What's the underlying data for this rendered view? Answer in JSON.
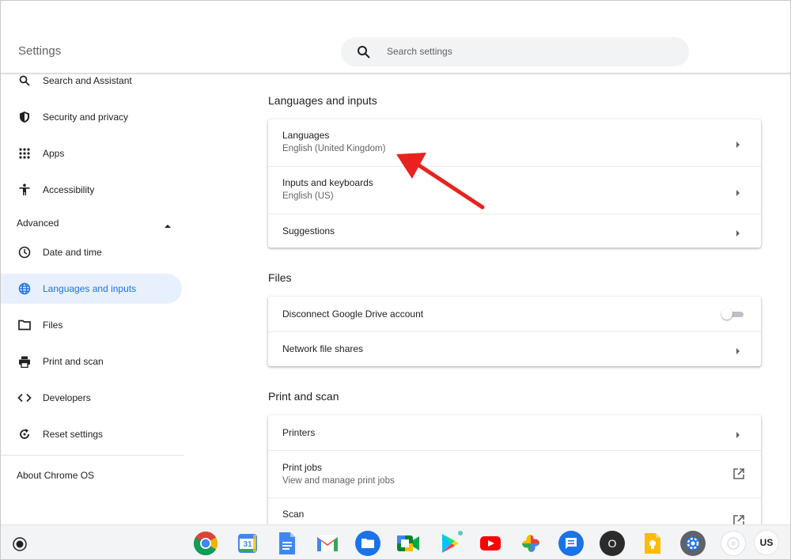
{
  "header": {
    "title": "Settings",
    "search_placeholder": "Search settings"
  },
  "sidebar": {
    "items": [
      {
        "label": "Search and Assistant",
        "icon": "search-icon"
      },
      {
        "label": "Security and privacy",
        "icon": "shield-icon"
      },
      {
        "label": "Apps",
        "icon": "apps-grid-icon"
      },
      {
        "label": "Accessibility",
        "icon": "accessibility-icon"
      }
    ],
    "advanced_label": "Advanced",
    "advanced_items": [
      {
        "label": "Date and time",
        "icon": "clock-icon"
      },
      {
        "label": "Languages and inputs",
        "icon": "globe-icon",
        "active": true
      },
      {
        "label": "Files",
        "icon": "folder-icon"
      },
      {
        "label": "Print and scan",
        "icon": "printer-icon"
      },
      {
        "label": "Developers",
        "icon": "code-icon"
      },
      {
        "label": "Reset settings",
        "icon": "reset-icon"
      }
    ],
    "about_label": "About Chrome OS"
  },
  "main": {
    "sections": [
      {
        "title": "Languages and inputs",
        "rows": [
          {
            "title": "Languages",
            "subtitle": "English (United Kingdom)",
            "action": "chevron"
          },
          {
            "title": "Inputs and keyboards",
            "subtitle": "English (US)",
            "action": "chevron"
          },
          {
            "title": "Suggestions",
            "action": "chevron"
          }
        ]
      },
      {
        "title": "Files",
        "rows": [
          {
            "title": "Disconnect Google Drive account",
            "action": "toggle",
            "toggle_on": false
          },
          {
            "title": "Network file shares",
            "action": "chevron"
          }
        ]
      },
      {
        "title": "Print and scan",
        "rows": [
          {
            "title": "Printers",
            "action": "chevron"
          },
          {
            "title": "Print jobs",
            "subtitle": "View and manage print jobs",
            "action": "external"
          },
          {
            "title": "Scan",
            "action": "external"
          }
        ]
      }
    ]
  },
  "shelf": {
    "apps": [
      {
        "name": "Chrome",
        "icon": "chrome-icon"
      },
      {
        "name": "Calendar",
        "icon": "calendar-icon",
        "text": "31"
      },
      {
        "name": "Docs",
        "icon": "docs-icon"
      },
      {
        "name": "Gmail",
        "icon": "gmail-icon",
        "text": "M"
      },
      {
        "name": "Files",
        "icon": "files-icon"
      },
      {
        "name": "Meet",
        "icon": "meet-icon"
      },
      {
        "name": "Play Store",
        "icon": "play-store-icon"
      },
      {
        "name": "YouTube",
        "icon": "youtube-icon"
      },
      {
        "name": "Photos",
        "icon": "photos-icon"
      },
      {
        "name": "Messages",
        "icon": "messages-icon"
      },
      {
        "name": "Opera",
        "icon": "opera-icon",
        "text": "O"
      },
      {
        "name": "Keep",
        "icon": "keep-icon"
      },
      {
        "name": "Settings",
        "icon": "settings-gear-icon"
      },
      {
        "name": "Camera",
        "icon": "camera-icon"
      }
    ],
    "ime_label": "US"
  },
  "colors": {
    "accent": "#1a73e8",
    "active_bg": "#e8f0fe",
    "annotation_arrow": "#e8231f"
  }
}
